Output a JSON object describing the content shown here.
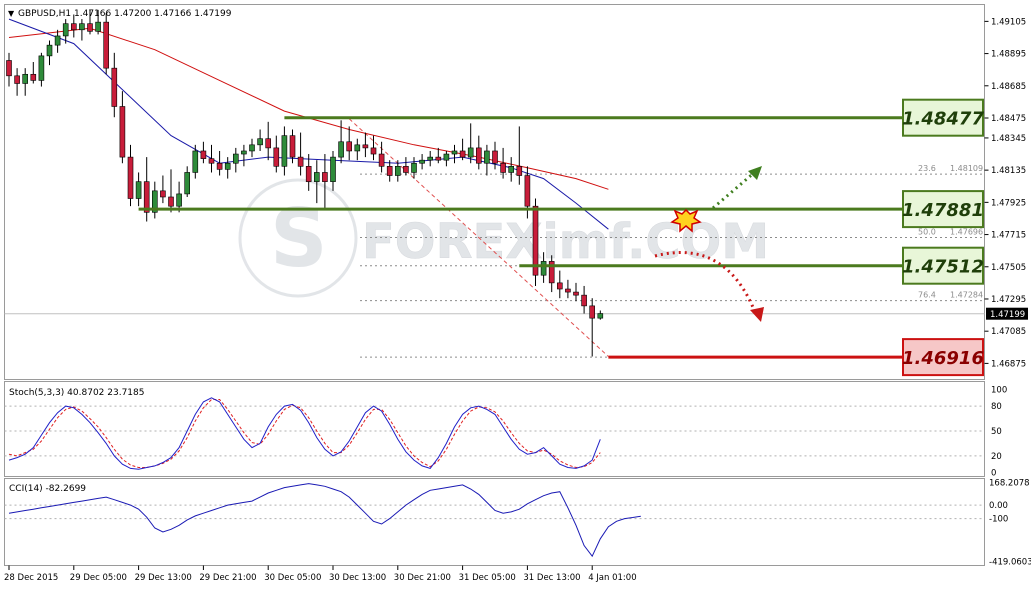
{
  "chart_data": {
    "type": "candlestick",
    "symbol_header": "GBPUSD,H1  1.47166 1.47200 1.47166 1.47199",
    "watermark": "FOREXimf.COM",
    "price_axis": {
      "ylim": [
        1.4677,
        1.49215
      ],
      "ticks": [
        "1.49105",
        "1.48895",
        "1.48685",
        "1.48475",
        "1.48345",
        "1.48135",
        "1.47925",
        "1.47715",
        "1.47505",
        "1.47295",
        "1.47085",
        "1.46875"
      ],
      "current_price_label": "1.47199",
      "current_price": 1.47199
    },
    "time_axis": {
      "labels": [
        "28 Dec 2015",
        "29 Dec 05:00",
        "29 Dec 13:00",
        "29 Dec 21:00",
        "30 Dec 05:00",
        "30 Dec 13:00",
        "30 Dec 21:00",
        "31 Dec 05:00",
        "31 Dec 13:00",
        "4 Jan 01:00"
      ],
      "label_index": [
        0,
        8,
        16,
        24,
        32,
        40,
        48,
        56,
        64,
        72
      ]
    },
    "candles": [
      [
        1.4885,
        1.489,
        1.4868,
        1.4875
      ],
      [
        1.4875,
        1.488,
        1.4862,
        1.487
      ],
      [
        1.487,
        1.488,
        1.4862,
        1.4876
      ],
      [
        1.4876,
        1.4884,
        1.487,
        1.4872
      ],
      [
        1.4872,
        1.489,
        1.4868,
        1.4888
      ],
      [
        1.4888,
        1.4898,
        1.4882,
        1.4895
      ],
      [
        1.4895,
        1.4905,
        1.489,
        1.4901
      ],
      [
        1.4901,
        1.4912,
        1.4896,
        1.4909
      ],
      [
        1.4909,
        1.4915,
        1.49,
        1.4905
      ],
      [
        1.4905,
        1.4912,
        1.4898,
        1.4909
      ],
      [
        1.4909,
        1.4918,
        1.4902,
        1.4904
      ],
      [
        1.4904,
        1.4918,
        1.4902,
        1.491
      ],
      [
        1.491,
        1.4916,
        1.4876,
        1.488
      ],
      [
        1.488,
        1.489,
        1.4848,
        1.4855
      ],
      [
        1.4855,
        1.4865,
        1.4818,
        1.4822
      ],
      [
        1.4822,
        1.483,
        1.479,
        1.4795
      ],
      [
        1.4795,
        1.4812,
        1.479,
        1.4806
      ],
      [
        1.4806,
        1.4822,
        1.478,
        1.4786
      ],
      [
        1.4786,
        1.4806,
        1.4782,
        1.48
      ],
      [
        1.48,
        1.481,
        1.4792,
        1.4796
      ],
      [
        1.4796,
        1.4814,
        1.4786,
        1.479
      ],
      [
        1.479,
        1.4806,
        1.4786,
        1.4798
      ],
      [
        1.4798,
        1.4816,
        1.4796,
        1.4812
      ],
      [
        1.4812,
        1.483,
        1.4808,
        1.4826
      ],
      [
        1.4826,
        1.4832,
        1.4818,
        1.4821
      ],
      [
        1.4821,
        1.483,
        1.4812,
        1.4818
      ],
      [
        1.4818,
        1.4826,
        1.481,
        1.4814
      ],
      [
        1.4814,
        1.4822,
        1.4808,
        1.4818
      ],
      [
        1.4818,
        1.4828,
        1.4812,
        1.4824
      ],
      [
        1.4824,
        1.483,
        1.4816,
        1.4826
      ],
      [
        1.4826,
        1.4834,
        1.4822,
        1.483
      ],
      [
        1.483,
        1.484,
        1.4826,
        1.4834
      ],
      [
        1.4834,
        1.4845,
        1.482,
        1.4828
      ],
      [
        1.4828,
        1.4836,
        1.4812,
        1.4816
      ],
      [
        1.4816,
        1.4842,
        1.481,
        1.4836
      ],
      [
        1.4836,
        1.484,
        1.4818,
        1.4822
      ],
      [
        1.4822,
        1.4838,
        1.481,
        1.4816
      ],
      [
        1.4816,
        1.4824,
        1.48,
        1.4806
      ],
      [
        1.4806,
        1.482,
        1.4792,
        1.4812
      ],
      [
        1.4812,
        1.4824,
        1.4788,
        1.4806
      ],
      [
        1.4806,
        1.4826,
        1.48,
        1.4822
      ],
      [
        1.4822,
        1.4846,
        1.4818,
        1.4832
      ],
      [
        1.4832,
        1.4842,
        1.482,
        1.4826
      ],
      [
        1.4826,
        1.4834,
        1.482,
        1.483
      ],
      [
        1.483,
        1.4838,
        1.4822,
        1.4828
      ],
      [
        1.4828,
        1.4836,
        1.482,
        1.4824
      ],
      [
        1.4824,
        1.4832,
        1.4812,
        1.4816
      ],
      [
        1.4816,
        1.482,
        1.4806,
        1.481
      ],
      [
        1.481,
        1.482,
        1.4806,
        1.4816
      ],
      [
        1.4816,
        1.4822,
        1.481,
        1.4812
      ],
      [
        1.4812,
        1.4822,
        1.4808,
        1.4818
      ],
      [
        1.4818,
        1.4824,
        1.4814,
        1.482
      ],
      [
        1.482,
        1.4826,
        1.4816,
        1.4822
      ],
      [
        1.4822,
        1.4828,
        1.4818,
        1.482
      ],
      [
        1.482,
        1.4826,
        1.4816,
        1.4824
      ],
      [
        1.4824,
        1.483,
        1.4818,
        1.4826
      ],
      [
        1.4826,
        1.4834,
        1.482,
        1.4822
      ],
      [
        1.4822,
        1.4844,
        1.4818,
        1.4828
      ],
      [
        1.4828,
        1.4836,
        1.4814,
        1.4818
      ],
      [
        1.4818,
        1.483,
        1.481,
        1.4826
      ],
      [
        1.4826,
        1.4832,
        1.4814,
        1.4818
      ],
      [
        1.4818,
        1.4828,
        1.4808,
        1.4812
      ],
      [
        1.4812,
        1.4822,
        1.4806,
        1.4816
      ],
      [
        1.4816,
        1.4842,
        1.4804,
        1.481
      ],
      [
        1.481,
        1.4816,
        1.4782,
        1.479
      ],
      [
        1.479,
        1.4795,
        1.4738,
        1.4745
      ],
      [
        1.4745,
        1.476,
        1.474,
        1.4754
      ],
      [
        1.4754,
        1.4758,
        1.4734,
        1.474
      ],
      [
        1.474,
        1.4748,
        1.473,
        1.4736
      ],
      [
        1.4736,
        1.4742,
        1.473,
        1.4734
      ],
      [
        1.4734,
        1.474,
        1.4728,
        1.4732
      ],
      [
        1.4732,
        1.4738,
        1.472,
        1.4725
      ],
      [
        1.4725,
        1.473,
        1.4692,
        1.4717
      ],
      [
        1.4717,
        1.4722,
        1.4716,
        1.472
      ]
    ],
    "ma_fast": [
      [
        0,
        1.4912
      ],
      [
        8,
        1.4896
      ],
      [
        14,
        1.4866
      ],
      [
        20,
        1.4836
      ],
      [
        26,
        1.4818
      ],
      [
        32,
        1.4822
      ],
      [
        40,
        1.482
      ],
      [
        48,
        1.4818
      ],
      [
        56,
        1.4822
      ],
      [
        62,
        1.4815
      ],
      [
        66,
        1.4808
      ],
      [
        70,
        1.4792
      ],
      [
        74,
        1.4775
      ]
    ],
    "ma_slow": [
      [
        0,
        1.49
      ],
      [
        10,
        1.4906
      ],
      [
        18,
        1.4892
      ],
      [
        26,
        1.4872
      ],
      [
        34,
        1.4852
      ],
      [
        42,
        1.484
      ],
      [
        50,
        1.483
      ],
      [
        58,
        1.4822
      ],
      [
        64,
        1.4815
      ],
      [
        70,
        1.4808
      ],
      [
        74,
        1.4801
      ]
    ],
    "dashed_trendline": [
      [
        42,
        1.4847
      ],
      [
        74,
        1.4692
      ]
    ],
    "levels": [
      {
        "label": "1.48477",
        "value": 1.48477,
        "color": "#4b7a1e",
        "from": 34
      },
      {
        "label": "1.47881",
        "value": 1.47881,
        "color": "#4b7a1e",
        "from": 16
      },
      {
        "label": "1.47512",
        "value": 1.47512,
        "color": "#4b7a1e",
        "from": 63
      },
      {
        "label": "1.46916",
        "value": 1.46916,
        "color": "#cc1111",
        "from": 74
      }
    ],
    "fib_levels": [
      {
        "ratio": "23.6",
        "value": 1.48109,
        "text": "1.48109"
      },
      {
        "ratio": "50.0",
        "value": 1.47696,
        "text": "1.47696"
      },
      {
        "ratio": "76.4",
        "value": 1.47284,
        "text": "1.47284"
      }
    ],
    "fib_extra_lines": [
      1.47512,
      1.46916
    ],
    "stochastic": {
      "label": "Stoch(5,3,3) 40.8702 23.7185",
      "ticks": [
        "100",
        "80",
        "50",
        "20",
        "0"
      ],
      "main": [
        15,
        18,
        22,
        30,
        45,
        60,
        72,
        80,
        78,
        70,
        60,
        48,
        35,
        20,
        10,
        5,
        4,
        6,
        8,
        12,
        18,
        30,
        50,
        70,
        85,
        90,
        85,
        70,
        55,
        40,
        30,
        35,
        55,
        70,
        80,
        82,
        75,
        60,
        42,
        28,
        20,
        25,
        38,
        55,
        72,
        80,
        74,
        58,
        40,
        25,
        15,
        8,
        5,
        18,
        35,
        55,
        70,
        78,
        80,
        76,
        70,
        55,
        40,
        28,
        22,
        24,
        30,
        20,
        10,
        6,
        5,
        8,
        15,
        40
      ],
      "signal": [
        22,
        20,
        24,
        28,
        38,
        52,
        66,
        76,
        79,
        74,
        65,
        55,
        42,
        28,
        16,
        9,
        6,
        6,
        8,
        11,
        16,
        26,
        42,
        62,
        78,
        88,
        88,
        76,
        62,
        48,
        36,
        34,
        46,
        62,
        76,
        81,
        78,
        66,
        50,
        35,
        24,
        24,
        33,
        48,
        64,
        76,
        76,
        64,
        48,
        32,
        20,
        12,
        7,
        14,
        28,
        46,
        62,
        74,
        79,
        78,
        73,
        62,
        48,
        35,
        26,
        24,
        27,
        22,
        14,
        9,
        6,
        7,
        12,
        24
      ]
    },
    "cci": {
      "label": "CCI(14) -82.2699",
      "ticks": [
        "168.2078",
        "0.00",
        "-100",
        "-419.0603"
      ],
      "ylim": [
        -419.0603,
        168.2078
      ],
      "values": [
        -60,
        -50,
        -40,
        -30,
        -20,
        -10,
        0,
        10,
        20,
        30,
        40,
        50,
        60,
        40,
        20,
        0,
        -30,
        -90,
        -170,
        -200,
        -180,
        -150,
        -110,
        -80,
        -60,
        -40,
        -20,
        0,
        10,
        20,
        30,
        60,
        90,
        110,
        130,
        140,
        150,
        160,
        150,
        140,
        120,
        100,
        60,
        0,
        -60,
        -120,
        -140,
        -100,
        -50,
        0,
        40,
        80,
        110,
        120,
        130,
        140,
        150,
        120,
        80,
        20,
        -40,
        -60,
        -50,
        -30,
        10,
        40,
        70,
        90,
        100,
        -20,
        -150,
        -300,
        -380,
        -250,
        -160,
        -120,
        -100,
        -92,
        -82
      ]
    }
  }
}
